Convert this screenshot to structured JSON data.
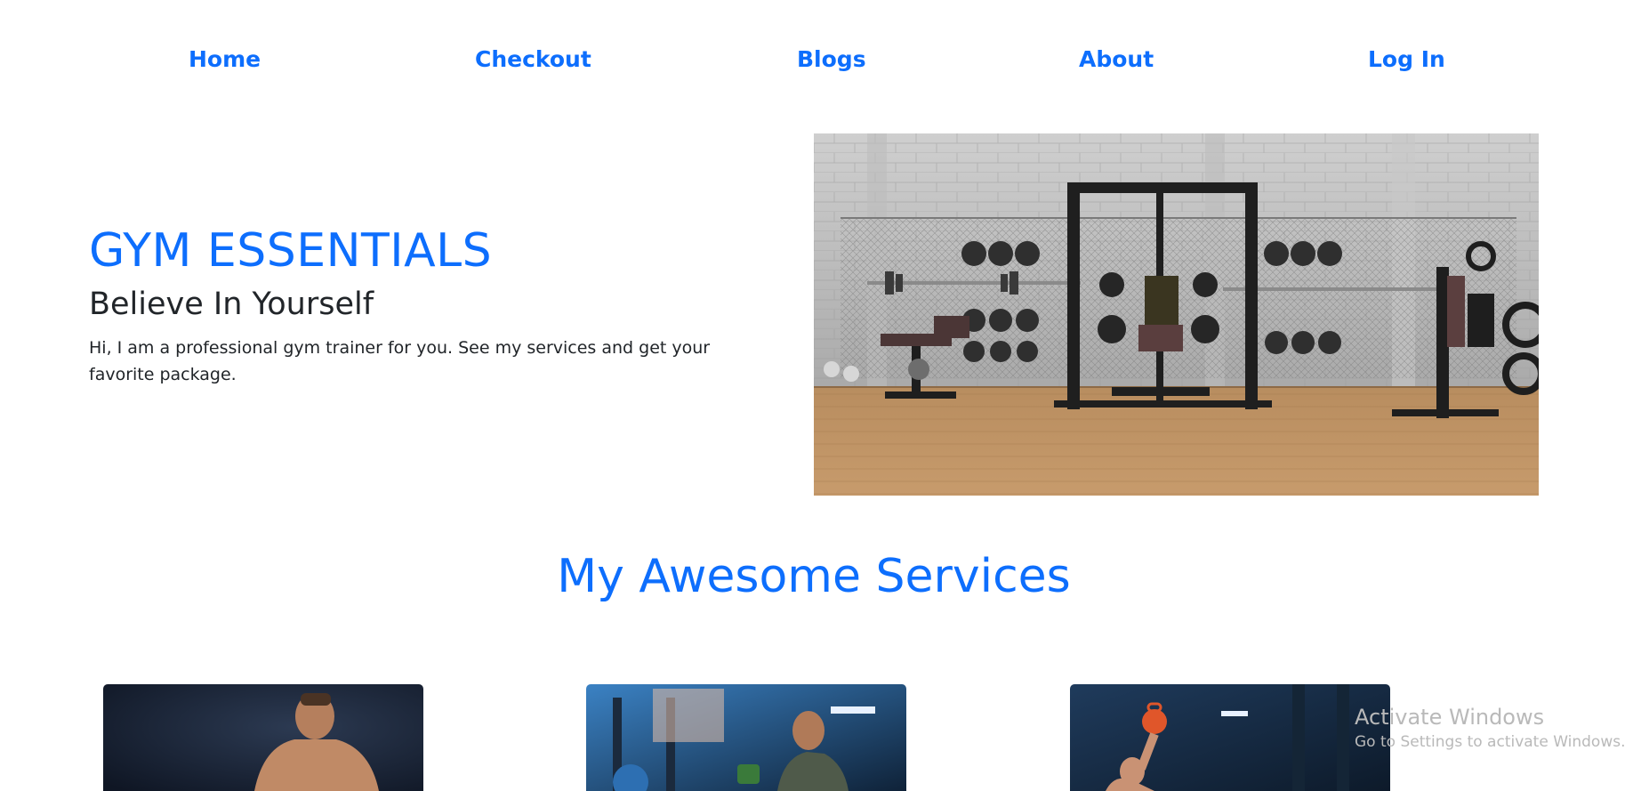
{
  "nav": {
    "items": [
      "Home",
      "Checkout",
      "Blogs",
      "About",
      "Log In"
    ]
  },
  "hero": {
    "title": "GYM ESSENTIALS",
    "subtitle": "Believe In Yourself",
    "description": "Hi, I am a professional gym trainer for you. See my services and get your favorite package."
  },
  "services": {
    "title": "My Awesome Services"
  },
  "watermark": {
    "title": "Activate Windows",
    "subtitle": "Go to Settings to activate Windows."
  },
  "colors": {
    "primary": "#0d6efd",
    "text": "#212529"
  }
}
